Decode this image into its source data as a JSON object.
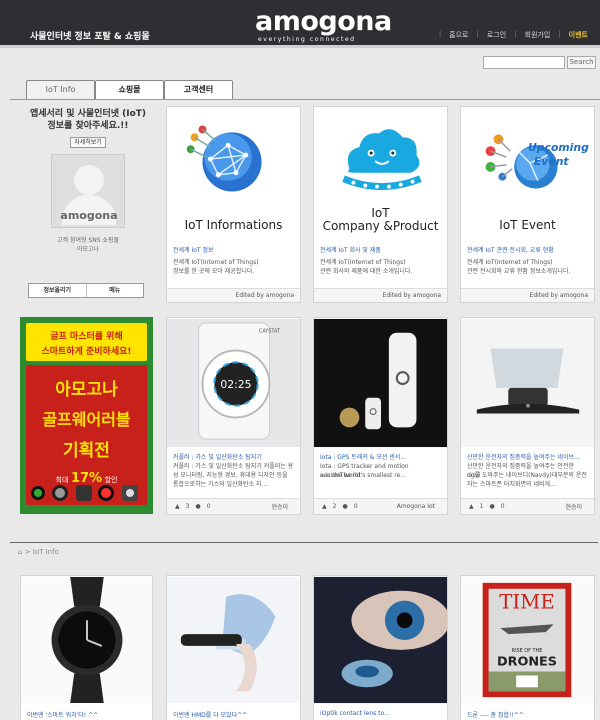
{
  "header": {
    "tagline": "사물인터넷 정보 포탈 & 쇼핑몰",
    "logo_word": "amogona",
    "logo_sub": "everything connected",
    "nav": [
      "홈으로",
      "로그인",
      "회원가입",
      "이벤트"
    ]
  },
  "search": {
    "button": "Search"
  },
  "tabs": [
    "IoT Info",
    "쇼핑몰",
    "고객센터"
  ],
  "profile": {
    "headline_1": "앱세서리 및 사물인터넷 (IoT)",
    "headline_2": "정보를 찾아주세요.!!",
    "more": "자세히보기",
    "avatar_brand": "amogona",
    "note_1": "고객 참여형 SNS 쇼핑몰",
    "note_2": "아모고나",
    "actions": [
      "정보올리기",
      "메뉴"
    ]
  },
  "info_cards": [
    {
      "title_1": "IoT Informations",
      "title_2": "",
      "link": "전세계 IoT 정보",
      "desc_1": "전세계 IoT(Internet of Things)",
      "desc_2": "정보를 한 곳에 모아 제공합니다.",
      "editor": "Edited by amogona"
    },
    {
      "title_1": "IoT",
      "title_2": "Company &Product",
      "link": "전세계 IoT 회사 및 제품",
      "desc_1": "전세계 IoT(Internet of Things)",
      "desc_2": "관련 회사와 제품에 대한 소개입니다.",
      "editor": "Edited by amogona"
    },
    {
      "title_1": "IoT Event",
      "title_2": "",
      "link": "전세계 IoT 관련 전시회, 교류 현황",
      "desc_1": "전세계 IoT(Internet of Things)",
      "desc_2": "관련 전시회와 교류 현황 정보소개입니다.",
      "editor": "Edited by amogona"
    }
  ],
  "promo": {
    "top_1": "골프 마스터를 위해",
    "top_2": "스마트하게 준비하세요!",
    "big_1": "아모고나",
    "big_2": "골프웨어러블",
    "big_3": "기획전",
    "discount_prefix": "최대",
    "discount": "17%",
    "discount_suffix": "할인"
  },
  "product_cards": [
    {
      "thumb_text": "02:25",
      "thumb_brand": "CAYSTAT",
      "link": "커플러 : 가스 및 일산화탄소 탐지기",
      "desc_1": "커플러 : 가스 및 일산화탄소 탐지기 커플러는 용",
      "desc_2": "성 모니터링, 지능형 경보, 휴대용 디자인 등을",
      "desc_3": "통합으로하는 가스와 일산화탄소 지...",
      "likes": "3",
      "comments": "0",
      "author": "현승이"
    },
    {
      "thumb_text": "",
      "thumb_brand": "",
      "link": "Iota : GPS 트래커 & 모션 센서...",
      "desc_1": "Iota : GPS tracker and motion sensorThe Iot",
      "desc_2": "a is the world's smallest re...",
      "desc_3": "",
      "likes": "2",
      "comments": "0",
      "author": "Amogona Iot"
    },
    {
      "thumb_text": "",
      "thumb_brand": "",
      "link": "산만한 운전자의 집중력을 높여주는 네이브...",
      "desc_1": "산만한 운전자의 집중력을 높여주는 안전한 drivi",
      "desc_2": "ng를 도와주는 네이브디(Navdy)대부분의 운전",
      "desc_3": "자는 스마트폰 터치화면의 네비게...",
      "likes": "1",
      "comments": "0",
      "author": "현승이"
    }
  ],
  "breadcrumb": {
    "sep": ">",
    "current": "IoT Info"
  },
  "bottom_cards": [
    {
      "link": "이번엔 '스마트 워치'다! ^^",
      "extra": ""
    },
    {
      "link": "이번엔 HMD를 다 모았다^^",
      "extra": ""
    },
    {
      "link": "iOptik contact lens to...",
      "extra": ""
    },
    {
      "link": "드론 ---- 총 집합!!^^",
      "extra": "TIME",
      "headline_1": "RISE OF THE",
      "headline_2": "DRONES"
    }
  ],
  "colors": {
    "header_bg": "#2f2f33",
    "link_blue": "#2a5db0",
    "event_yellow": "#f0c020",
    "promo_red": "#c8201a",
    "promo_green": "#2e8b30",
    "promo_yellow": "#ffe400"
  }
}
